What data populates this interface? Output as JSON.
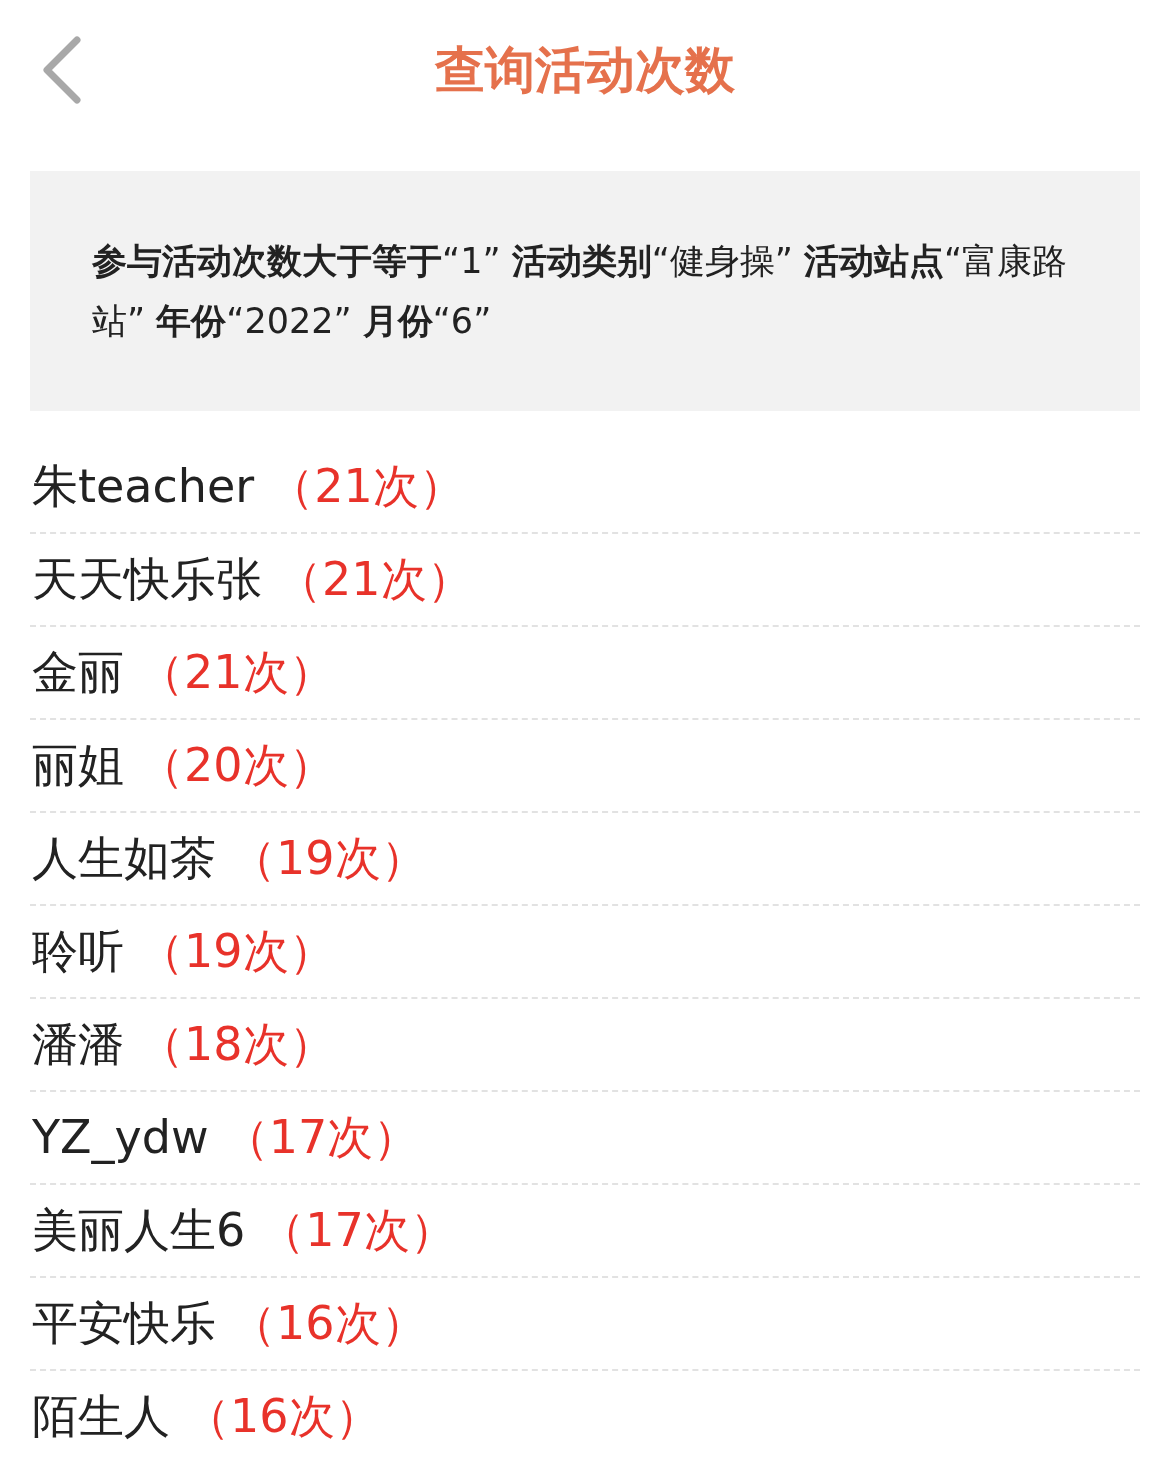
{
  "header": {
    "title": "查询活动次数"
  },
  "filter": {
    "text": "**参与活动次数大于等于**“1” **活动类别**“健身操” **活动站点**“富康路站” **年份**“2022” **月份**“6”"
  },
  "rows": [
    {
      "name": "朱teacher",
      "count": "（21次）"
    },
    {
      "name": "天天快乐张",
      "count": "（21次）"
    },
    {
      "name": "金丽",
      "count": "（21次）"
    },
    {
      "name": "丽姐",
      "count": "（20次）"
    },
    {
      "name": "人生如茶",
      "count": "（19次）"
    },
    {
      "name": "聆听",
      "count": "（19次）"
    },
    {
      "name": "潘潘",
      "count": "（18次）"
    },
    {
      "name": "YZ_ydw",
      "count": "（17次）"
    },
    {
      "name": "美丽人生6",
      "count": "（17次）"
    },
    {
      "name": "平安快乐",
      "count": "（16次）"
    },
    {
      "name": "陌生人",
      "count": "（16次）"
    }
  ]
}
